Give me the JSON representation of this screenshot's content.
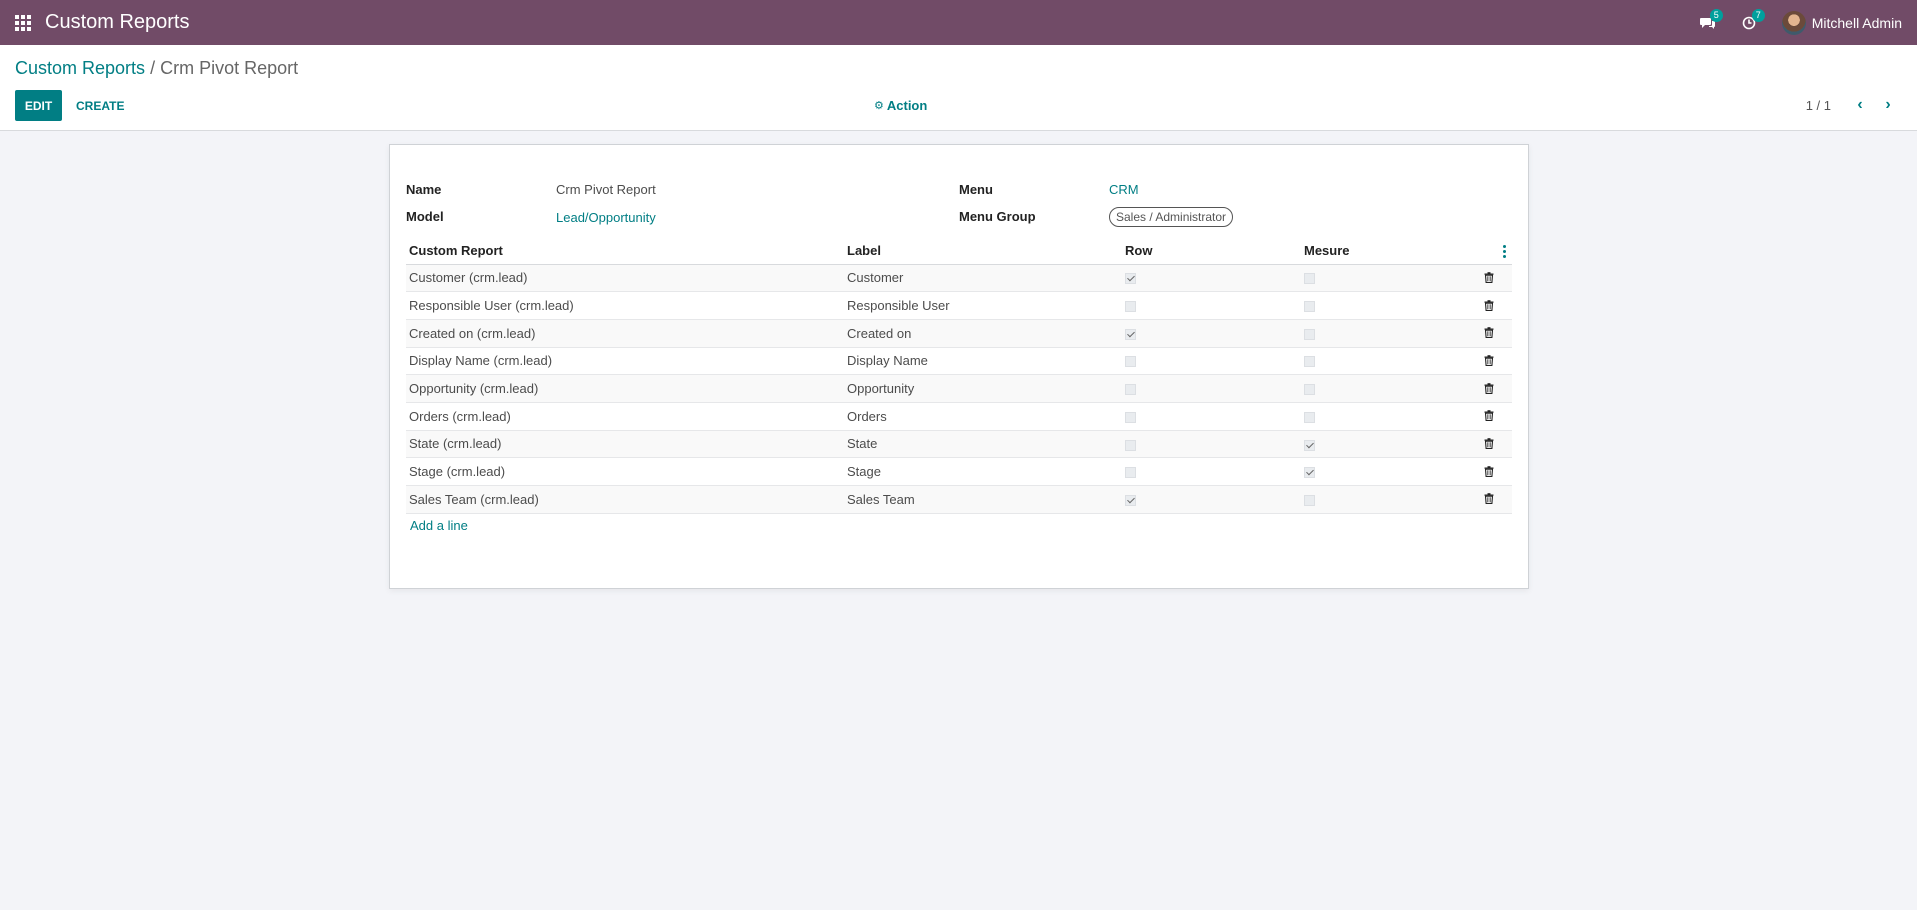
{
  "navbar": {
    "app_title": "Custom Reports",
    "messages_count": "5",
    "activities_count": "7",
    "user_name": "Mitchell Admin"
  },
  "breadcrumb": {
    "parent": "Custom Reports",
    "separator": "/",
    "current": "Crm Pivot Report"
  },
  "toolbar": {
    "edit_label": "EDIT",
    "create_label": "CREATE",
    "action_label": "Action",
    "pager": "1 / 1"
  },
  "form": {
    "name_label": "Name",
    "name_value": "Crm Pivot Report",
    "model_label": "Model",
    "model_value": "Lead/Opportunity",
    "menu_label": "Menu",
    "menu_value": "CRM",
    "menu_group_label": "Menu Group",
    "menu_group_value": "Sales / Administrator"
  },
  "table": {
    "columns": [
      "Custom Report",
      "Label",
      "Row",
      "Mesure"
    ],
    "rows": [
      {
        "field": "Customer (crm.lead)",
        "label": "Customer",
        "row": true,
        "measure": false
      },
      {
        "field": "Responsible User (crm.lead)",
        "label": "Responsible User",
        "row": false,
        "measure": false
      },
      {
        "field": "Created on (crm.lead)",
        "label": "Created on",
        "row": true,
        "measure": false
      },
      {
        "field": "Display Name (crm.lead)",
        "label": "Display Name",
        "row": false,
        "measure": false
      },
      {
        "field": "Opportunity (crm.lead)",
        "label": "Opportunity",
        "row": false,
        "measure": false
      },
      {
        "field": "Orders (crm.lead)",
        "label": "Orders",
        "row": false,
        "measure": false
      },
      {
        "field": "State (crm.lead)",
        "label": "State",
        "row": false,
        "measure": true
      },
      {
        "field": "Stage (crm.lead)",
        "label": "Stage",
        "row": false,
        "measure": true
      },
      {
        "field": "Sales Team (crm.lead)",
        "label": "Sales Team",
        "row": true,
        "measure": false
      }
    ],
    "add_line_label": "Add a line"
  },
  "colors": {
    "navbar": "#714b67",
    "primary": "#017e84",
    "background": "#f3f4f8"
  }
}
